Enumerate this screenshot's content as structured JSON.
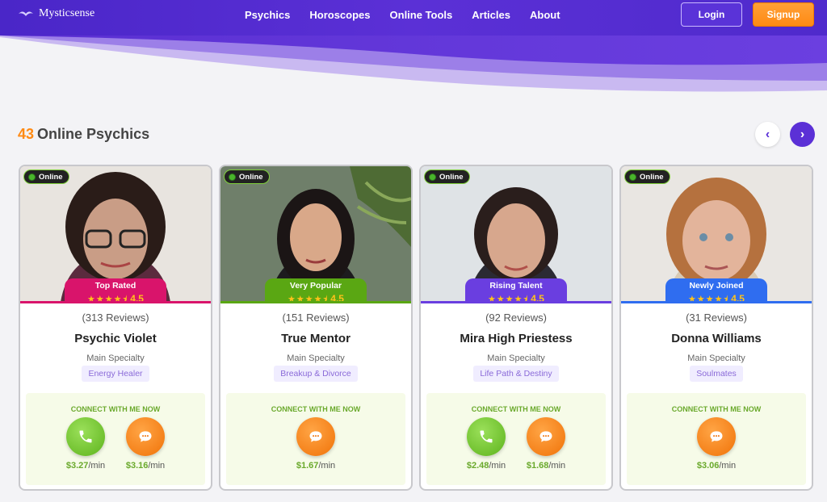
{
  "header": {
    "logo": "Mysticsense",
    "nav": [
      "Psychics",
      "Horoscopes",
      "Online Tools",
      "Articles",
      "About"
    ],
    "login": "Login",
    "signup": "Signup"
  },
  "section": {
    "count": "43",
    "title": "Online Psychics",
    "prev_icon": "chevron-left-icon",
    "next_icon": "chevron-right-icon"
  },
  "colors": {
    "brand": "#5b30d6",
    "accent": "#ff8a13",
    "online": "#49b62b"
  },
  "psychics": [
    {
      "status": "Online",
      "badge": "Top Rated",
      "badge_color": "#d9146b",
      "rating": "4.5",
      "reviews": "(313 Reviews)",
      "name": "Psychic Violet",
      "specialty_label": "Main Specialty",
      "specialty": "Energy Healer",
      "connect_label": "CONNECT WITH ME NOW",
      "phone_price": "$3.27",
      "chat_price": "$3.16",
      "unit": "/min"
    },
    {
      "status": "Online",
      "badge": "Very Popular",
      "badge_color": "#5aa713",
      "rating": "4.5",
      "reviews": "(151 Reviews)",
      "name": "True Mentor",
      "specialty_label": "Main Specialty",
      "specialty": "Breakup & Divorce",
      "connect_label": "CONNECT WITH ME NOW",
      "chat_price": "$1.67",
      "unit": "/min"
    },
    {
      "status": "Online",
      "badge": "Rising Talent",
      "badge_color": "#6a3ee0",
      "rating": "4.5",
      "reviews": "(92 Reviews)",
      "name": "Mira High Priestess",
      "specialty_label": "Main Specialty",
      "specialty": "Life Path & Destiny",
      "connect_label": "CONNECT WITH ME NOW",
      "phone_price": "$2.48",
      "chat_price": "$1.68",
      "unit": "/min"
    },
    {
      "status": "Online",
      "badge": "Newly Joined",
      "badge_color": "#2f6df0",
      "rating": "4.5",
      "reviews": "(31 Reviews)",
      "name": "Donna Williams",
      "specialty_label": "Main Specialty",
      "specialty": "Soulmates",
      "connect_label": "CONNECT WITH ME NOW",
      "chat_price": "$3.06",
      "unit": "/min"
    }
  ]
}
